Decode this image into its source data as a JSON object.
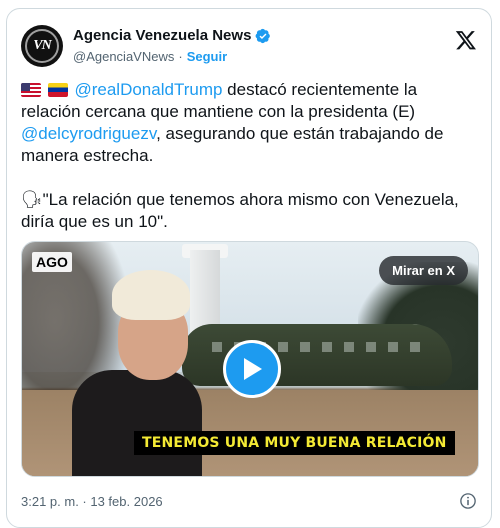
{
  "account": {
    "display_name": "Agencia Venezuela News",
    "handle": "@AgenciaVNews",
    "separator": "·",
    "follow_label": "Seguir",
    "avatar_text": "VN",
    "verified_color": "#1d9bf0"
  },
  "tweet": {
    "mention_trump": "@realDonaldTrump",
    "text_part1": " destacó recientemente la relación cercana que mantiene con la presidenta (E) ",
    "mention_delcy": "@delcyrodriguezv",
    "text_part2": ", asegurando que están trabajando de manera estrecha.",
    "speaking_head": "🗣",
    "quote": "\"La relación que tenemos ahora mismo con Venezuela, diría que es un 10\"."
  },
  "media": {
    "badge": "AGO",
    "watch_label": "Mirar en X",
    "caption": "TENEMOS UNA MUY BUENA RELACIÓN",
    "play_color": "#1d9bf0"
  },
  "footer": {
    "timestamp": "3:21 p. m. · 13 feb. 2026"
  },
  "colors": {
    "link": "#1d9bf0",
    "muted": "#536471",
    "text": "#0f1419",
    "caption_text": "#f4ea34"
  }
}
